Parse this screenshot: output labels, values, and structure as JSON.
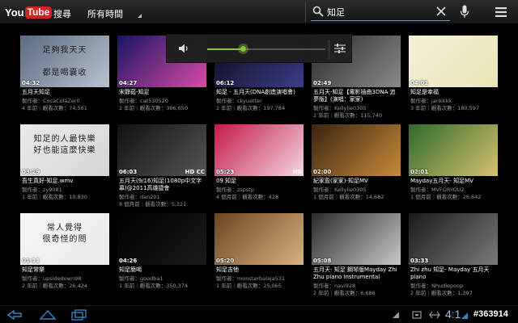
{
  "topbar": {
    "logo_you": "You",
    "logo_tube": "Tube",
    "search_tab": "搜尋",
    "time_filter": "所有時間",
    "query": "知足"
  },
  "clock": "4:1",
  "watermark": "#363914",
  "videos": [
    {
      "duration": "04:32",
      "title": "五月天知足",
      "author": "製作者：CocaColaZer0",
      "meta": "4 年前｜觀看次數：74,561",
      "caption": "足夠我天天\n\n都是喝囊收",
      "colors": [
        "#5b6a82",
        "#b9c2cf"
      ]
    },
    {
      "duration": "04:27",
      "title": "宋靜茹-知足",
      "author": "製作者：cat530520",
      "meta": "2 年前｜觀看次數：306,650",
      "caption": "",
      "colors": [
        "#1a1560",
        "#d84aa8"
      ]
    },
    {
      "duration": "06:12",
      "title": "知足 - 五月天(DNA創造演唱會)",
      "author": "製作者：ckyuatter",
      "meta": "2 年前｜觀看次數：197,784",
      "caption": "",
      "colors": [
        "#0b0b1a",
        "#3c3c8a"
      ]
    },
    {
      "duration": "02:49",
      "title": "五月天-知足【電影插曲3DNA 追夢版】(演唱：家家)",
      "author": "製作者：Kellylie0305",
      "meta": "2 年前｜觀看次數：115,740",
      "caption": "",
      "colors": [
        "#2a2a2a",
        "#8a8a8a"
      ]
    },
    {
      "duration": "04:01",
      "title": "知足是幸福",
      "author": "製作者：jankkkk",
      "meta": "3 年前｜觀看次數：180,597",
      "caption": "",
      "colors": [
        "#f4f1d8",
        "#e8e4b8"
      ]
    },
    {
      "duration": "03:29",
      "title": "吾生真好-知足.wmv",
      "author": "製作者：zy9081",
      "meta": "1 年前｜觀看次數：10,830",
      "caption": "知足的人最快樂\n好也能這麼快樂",
      "colors": [
        "#e9e9e9",
        "#d6d6d6"
      ]
    },
    {
      "duration": "06:03",
      "title": "五月天(9/16)知足(1080p中文字幕)@2011高雄捷會",
      "author": "製作者：dan201",
      "meta": "8 個月前｜觀看次數：5,321",
      "caption": "",
      "hd": "HD CC",
      "colors": [
        "#111",
        "#555"
      ]
    },
    {
      "duration": "05:23",
      "title": "09 知足",
      "author": "製作者：zspstp",
      "meta": "4 個月前｜觀看次數：428",
      "caption": "",
      "hd": "HD",
      "colors": [
        "#c21a4a",
        "#f5d6de"
      ]
    },
    {
      "duration": "02:00",
      "title": "紀家盈(家家)-知足MV",
      "author": "製作者：Kellylie0305",
      "meta": "1 個月前｜觀看次數：14,682",
      "caption": "",
      "colors": [
        "#3a2410",
        "#c88a3a"
      ]
    },
    {
      "duration": "02:01",
      "title": "Mayday五月天- 知足MV",
      "author": "製作者：MVFORYOU2",
      "meta": "1 個月前｜觀看次數：26,642",
      "caption": "",
      "colors": [
        "#2e6b2a",
        "#d8c070"
      ]
    },
    {
      "duration": "01:11",
      "title": "知足常樂",
      "author": "製作者：upsidedown98",
      "meta": "2 年前｜觀看次數：26,424",
      "caption": "常人覺得\n很奇怪的問",
      "colors": [
        "#f6f6f6",
        "#eaeaea"
      ]
    },
    {
      "duration": "04:26",
      "title": "知足簡喝",
      "author": "製作者：goodba1",
      "meta": "1 年前｜觀看次數：350,374",
      "caption": "",
      "colors": [
        "#000",
        "#1a1a1a"
      ]
    },
    {
      "duration": "05:20",
      "title": "知足吉他",
      "author": "製作者：monsterbalaja531",
      "meta": "1 年前｜觀看次數：25,065",
      "caption": "",
      "colors": [
        "#6b4520",
        "#d8b080"
      ]
    },
    {
      "duration": "05:08",
      "title": "五月天- 知足 鋼琴版Mayday Zhi Zhu piano instrumental version",
      "author": "製作者：navi928",
      "meta": "2 年前｜觀看次數：6,686",
      "caption": "",
      "colors": [
        "#2a2a2a",
        "#c8c8c8"
      ]
    },
    {
      "duration": "03:33",
      "title": "Zhi zhu 知足- Mayday 五月天 piano",
      "author": "製作者：Nhudlepoop",
      "meta": "2 年前｜觀看次數：1,397",
      "caption": "",
      "colors": [
        "#1a1a1a",
        "#7a7a7a"
      ]
    }
  ]
}
